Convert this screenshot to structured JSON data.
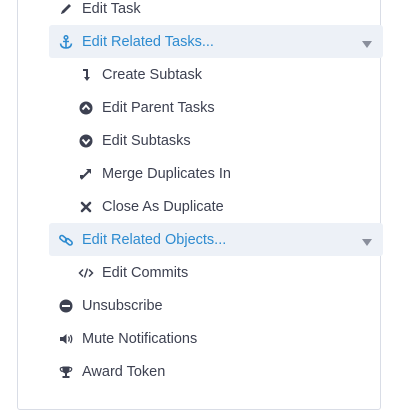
{
  "menu": {
    "edit_task": {
      "label": "Edit Task",
      "icon": "pencil-icon"
    },
    "related_tasks": {
      "label": "Edit Related Tasks...",
      "icon": "anchor-icon",
      "items": [
        {
          "label": "Create Subtask",
          "icon": "subtask-arrow-icon"
        },
        {
          "label": "Edit Parent Tasks",
          "icon": "parent-task-icon"
        },
        {
          "label": "Edit Subtasks",
          "icon": "subtasks-icon"
        },
        {
          "label": "Merge Duplicates In",
          "icon": "merge-icon"
        },
        {
          "label": "Close As Duplicate",
          "icon": "close-x-icon"
        }
      ]
    },
    "related_objects": {
      "label": "Edit Related Objects...",
      "icon": "link-icon",
      "items": [
        {
          "label": "Edit Commits",
          "icon": "code-icon"
        }
      ]
    },
    "unsubscribe": {
      "label": "Unsubscribe",
      "icon": "minus-circle-icon"
    },
    "mute": {
      "label": "Mute Notifications",
      "icon": "speaker-icon"
    },
    "award": {
      "label": "Award Token",
      "icon": "trophy-icon"
    }
  },
  "colors": {
    "text": "#3d4151",
    "accent": "#2d8bd0",
    "group_background": "#edf1f7",
    "border": "#d9dde6"
  }
}
